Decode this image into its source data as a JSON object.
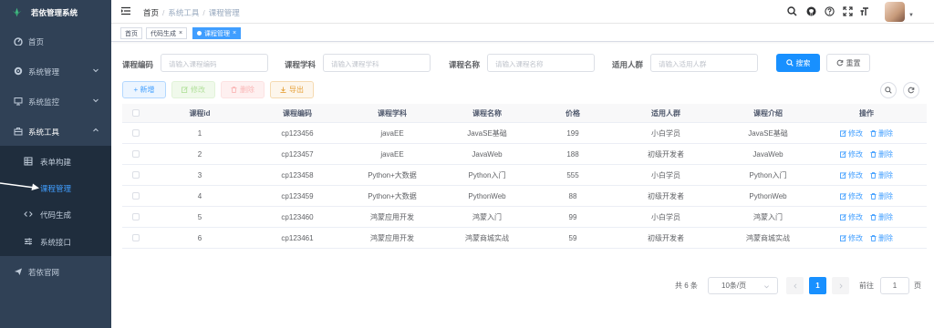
{
  "sidebar": {
    "logo": "若依管理系统",
    "items": [
      {
        "label": "首页",
        "icon": "dashboard-icon"
      },
      {
        "label": "系统管理",
        "icon": "gear-icon"
      },
      {
        "label": "系统监控",
        "icon": "monitor-icon"
      },
      {
        "label": "系统工具",
        "icon": "toolbox-icon"
      },
      {
        "label": "表单构建",
        "icon": "form-icon"
      },
      {
        "label": "课程管理",
        "icon": "blank-icon"
      },
      {
        "label": "代码生成",
        "icon": "code-icon"
      },
      {
        "label": "系统接口",
        "icon": "sliders-icon"
      },
      {
        "label": "若依官网",
        "icon": "send-icon"
      }
    ]
  },
  "header": {
    "breadcrumb": [
      "首页",
      "系统工具",
      "课程管理"
    ],
    "breadcrumb_sep": "/"
  },
  "tags": [
    {
      "label": "首页"
    },
    {
      "label": "代码生成",
      "close": "×"
    },
    {
      "label": "课程管理",
      "close": "×"
    }
  ],
  "search": {
    "fields": [
      {
        "label": "课程编码",
        "placeholder": "请输入课程编码"
      },
      {
        "label": "课程学科",
        "placeholder": "请输入课程学科"
      },
      {
        "label": "课程名称",
        "placeholder": "请输入课程名称"
      },
      {
        "label": "适用人群",
        "placeholder": "请输入适用人群"
      }
    ],
    "search_label": "搜索",
    "reset_label": "重置"
  },
  "toolbar": {
    "add_label": "+ 新增",
    "edit_label": "修改",
    "delete_label": "删除",
    "export_label": "导出"
  },
  "table": {
    "columns": [
      "课程id",
      "课程编码",
      "课程学科",
      "课程名称",
      "价格",
      "适用人群",
      "课程介绍",
      "操作"
    ],
    "rows": [
      [
        "1",
        "cp123456",
        "javaEE",
        "JavaSE基础",
        "199",
        "小白学员",
        "JavaSE基础"
      ],
      [
        "2",
        "cp123457",
        "javaEE",
        "JavaWeb",
        "188",
        "初级开发者",
        "JavaWeb"
      ],
      [
        "3",
        "cp123458",
        "Python+大数据",
        "Python入门",
        "555",
        "小白学员",
        "Python入门"
      ],
      [
        "4",
        "cp123459",
        "Python+大数据",
        "PythonWeb",
        "88",
        "初级开发者",
        "PythonWeb"
      ],
      [
        "5",
        "cp123460",
        "鸿蒙应用开发",
        "鸿蒙入门",
        "99",
        "小白学员",
        "鸿蒙入门"
      ],
      [
        "6",
        "cp123461",
        "鸿蒙应用开发",
        "鸿蒙商城实战",
        "59",
        "初级开发者",
        "鸿蒙商城实战"
      ]
    ],
    "edit_action": "修改",
    "delete_action": "删除"
  },
  "pagination": {
    "total": "共 6 条",
    "page_size": "10条/页",
    "current_page": "1",
    "goto_prefix": "前往",
    "goto_value": "1",
    "goto_suffix": "页"
  },
  "colors": {
    "sidebar_bg": "#304156",
    "primary": "#1890ff",
    "active_menu": "#409eff"
  }
}
